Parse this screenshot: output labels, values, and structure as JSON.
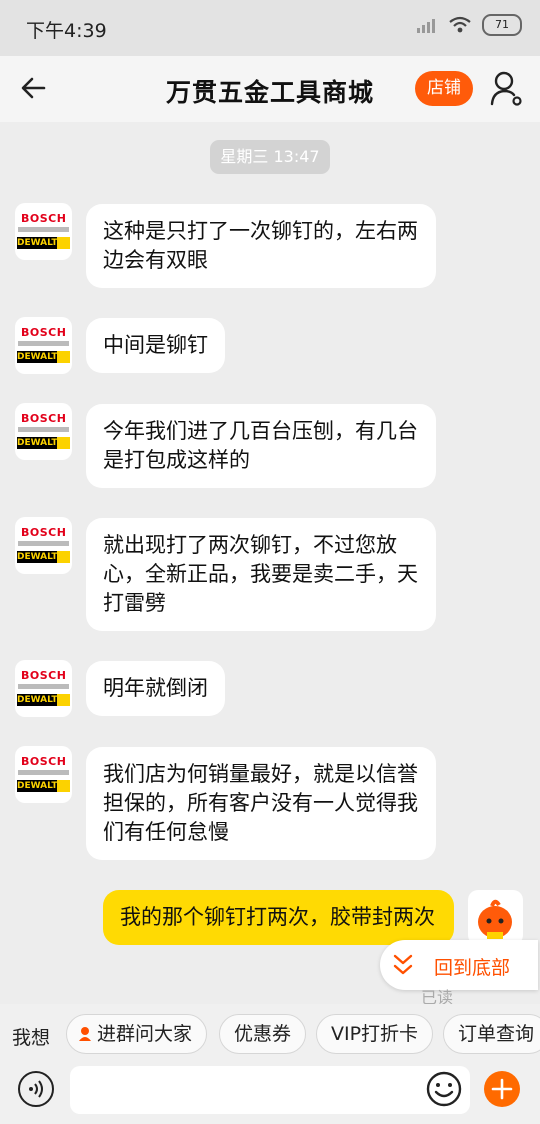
{
  "status_bar": {
    "time": "下午4:39",
    "battery": "71"
  },
  "header": {
    "title": "万贯五金工具商城",
    "shop_button": "店铺"
  },
  "chat": {
    "timestamp": "星期三 13:47",
    "avatar": {
      "brand_top": "BOSCH",
      "brand_bottom": "DEWALT"
    },
    "messages": [
      {
        "text": "这种是只打了一次铆钉的，左右两边会有双眼"
      },
      {
        "text": "中间是铆钉"
      },
      {
        "text": "今年我们进了几百台压刨，有几台是打包成这样的"
      },
      {
        "text": "就出现打了两次铆钉，不过您放心，全新正品，我要是卖二手，天打雷劈"
      },
      {
        "text": "明年就倒闭"
      },
      {
        "text": "我们店为何销量最好，就是以信誉担保的，所有客户没有一人觉得我们有任何怠慢"
      }
    ],
    "my_message": "我的那个铆钉打两次，胶带封两次",
    "back_to_bottom": "回到底部",
    "read_status": "已读"
  },
  "quick_bar": {
    "label": "我想",
    "chips": [
      "进群问大家",
      "优惠券",
      "VIP打折卡",
      "订单查询"
    ]
  },
  "colors": {
    "accent": "#ff5b0a",
    "my_bubble": "#ffda03"
  }
}
